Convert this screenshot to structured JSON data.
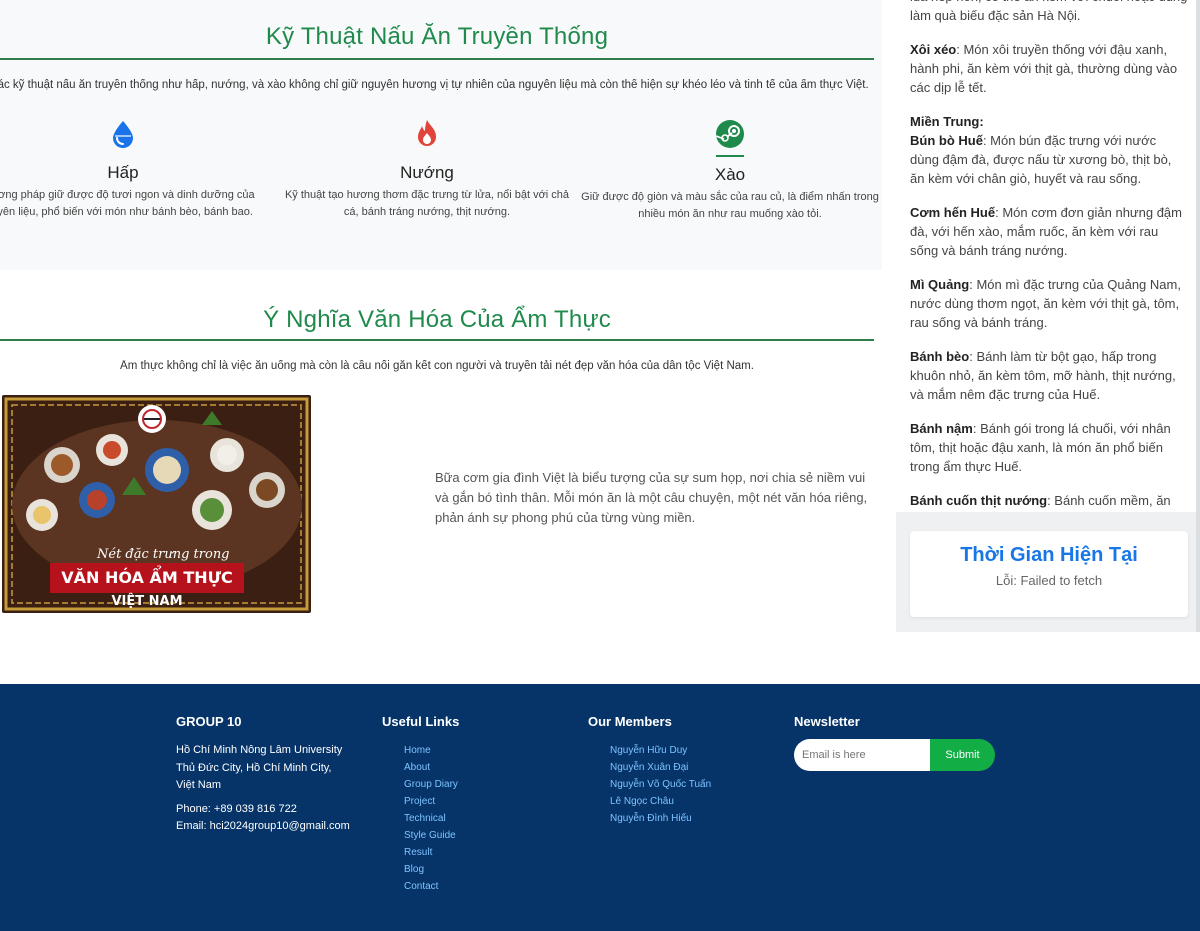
{
  "techniques": {
    "title": "Kỹ Thuật Nấu Ăn Truyền Thống",
    "description": "Các kỹ thuật nấu ăn truyền thống như hấp, nướng, và xào không chỉ giữ nguyên hương vị tự nhiên của nguyên liệu mà còn thể hiện sự khéo léo và tinh tế của ẩm thực Việt.",
    "items": [
      {
        "icon": "water-drop-icon",
        "name": "Hấp",
        "text": "Phương pháp giữ được độ tươi ngon và dinh dưỡng của nguyên liệu, phổ biến với món như bánh bèo, bánh bao."
      },
      {
        "icon": "fire-icon",
        "name": "Nướng",
        "text": "Kỹ thuật tạo hương thơm đặc trưng từ lửa, nổi bật với chả cá, bánh tráng nướng, thịt nướng."
      },
      {
        "icon": "steam-icon",
        "name": "Xào",
        "text": "Giữ được độ giòn và màu sắc của rau củ, là điểm nhấn trong nhiều món ăn như rau muống xào tỏi."
      }
    ]
  },
  "culture": {
    "title": "Ý Nghĩa Văn Hóa Của Ẩm Thực",
    "description": "Ẩm thực không chỉ là việc ăn uống mà còn là cầu nối gắn kết con người và truyền tải nét đẹp văn hóa của dân tộc Việt Nam.",
    "image": {
      "caption_top": "Nét đặc trưng trong",
      "caption_main": "VĂN HÓA ẨM THỰC",
      "caption_bottom": "VIỆT NAM"
    },
    "text": "Bữa cơm gia đình Việt là biểu tượng của sự sum họp, nơi chia sẻ niềm vui và gắn bó tình thân. Mỗi món ăn là một câu chuyện, một nét văn hóa riêng, phản ánh sự phong phú của từng vùng miền."
  },
  "sidebar": {
    "intro_tail": "lúa nếp non, có thể ăn kèm với chuối hoặc dùng làm quà biếu đặc sản Hà Nội.",
    "foods_north_tail": [
      {
        "name": "Xôi xéo",
        "desc": ": Món xôi truyền thống với đậu xanh, hành phi, ăn kèm với thịt gà, thường dùng vào các dịp lễ tết."
      }
    ],
    "region_central": "Miền Trung:",
    "foods_central": [
      {
        "name": "Bún bò Huế",
        "desc": ": Món bún đặc trưng với nước dùng đậm đà, được nấu từ xương bò, thịt bò, ăn kèm với chân giò, huyết và rau sống."
      },
      {
        "name": "Cơm hến Huế",
        "desc": ": Món cơm đơn giản nhưng đậm đà, với hến xào, mắm ruốc, ăn kèm với rau sống và bánh tráng nướng."
      },
      {
        "name": "Mì Quảng",
        "desc": ": Món mì đặc trưng của Quảng Nam, nước dùng thơm ngọt, ăn kèm với thịt gà, tôm, rau sống và bánh tráng."
      },
      {
        "name": "Bánh bèo",
        "desc": ": Bánh làm từ bột gạo, hấp trong khuôn nhỏ, ăn kèm tôm, mỡ hành, thịt nướng, và mắm nêm đặc trưng của Huế."
      },
      {
        "name": "Bánh nậm",
        "desc": ": Bánh gói trong lá chuối, với nhân tôm, thịt hoặc đậu xanh, là món ăn phổ biến trong ẩm thực Huế."
      },
      {
        "name": "Bánh cuốn thịt nướng",
        "desc": ": Bánh cuốn mềm, ăn kèm"
      }
    ],
    "time_title": "Thời Gian Hiện Tại",
    "time_status": "Lỗi: Failed to fetch"
  },
  "footer": {
    "group": {
      "heading": "GROUP 10",
      "address": [
        "Hồ Chí Minh Nông Lâm University",
        "Thủ Đức City, Hồ Chí Minh City,",
        "Việt Nam"
      ],
      "phone": "Phone: +89 039 816 722",
      "email": "Email: hci2024group10@gmail.com"
    },
    "links": {
      "heading": "Useful Links",
      "items": [
        "Home",
        "About",
        "Group Diary",
        "Project",
        "Technical",
        "Style Guide",
        "Result",
        "Blog",
        "Contact"
      ]
    },
    "members": {
      "heading": "Our Members",
      "items": [
        "Nguyễn Hữu Duy",
        "Nguyễn Xuân Đại",
        "Nguyễn Võ Quốc Tuấn",
        "Lê Ngọc Châu",
        "Nguyễn Đình Hiếu"
      ]
    },
    "newsletter": {
      "heading": "Newsletter",
      "placeholder": "Email is here",
      "button": "Submit"
    }
  },
  "colors": {
    "title_green": "#1f8a4c",
    "footer_bg": "#063469",
    "link_blue": "#7dc3ff",
    "submit_green": "#13ad45",
    "time_blue": "#1877e6"
  }
}
